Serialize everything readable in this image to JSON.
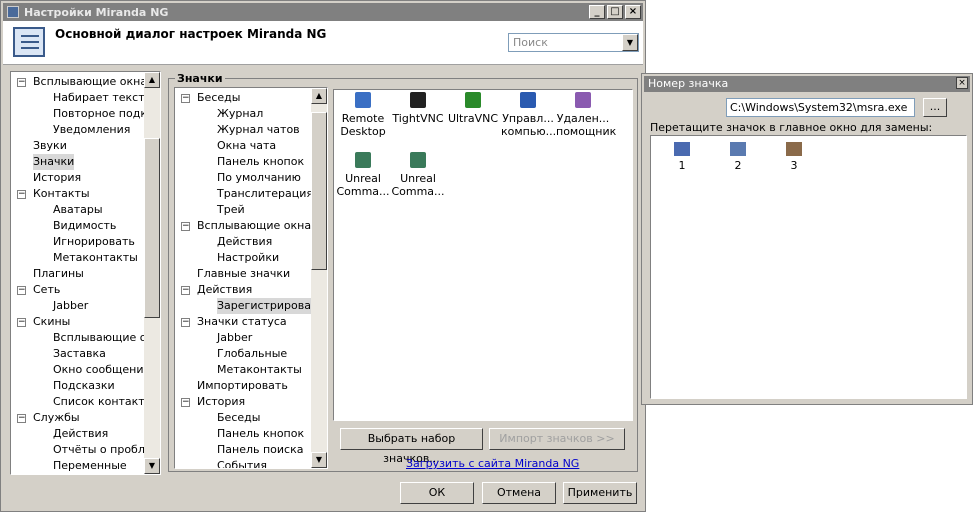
{
  "window": {
    "title": "Настройки Miranda NG",
    "btn_min": "_",
    "btn_max": "□",
    "btn_close": "×"
  },
  "header": {
    "title": "Основной диалог настроек Miranda NG",
    "search_placeholder": "Поиск"
  },
  "nav_tree": [
    {
      "label": "Всплывающие окна",
      "level": 0,
      "exp": "-"
    },
    {
      "label": "Набирает текст",
      "level": 1
    },
    {
      "label": "Повторное подкл",
      "level": 1
    },
    {
      "label": "Уведомления",
      "level": 1
    },
    {
      "label": "Звуки",
      "level": 0
    },
    {
      "label": "Значки",
      "level": 0,
      "selected": true
    },
    {
      "label": "История",
      "level": 0
    },
    {
      "label": "Контакты",
      "level": 0,
      "exp": "-"
    },
    {
      "label": "Аватары",
      "level": 1
    },
    {
      "label": "Видимость",
      "level": 1
    },
    {
      "label": "Игнорировать",
      "level": 1
    },
    {
      "label": "Метаконтакты",
      "level": 1
    },
    {
      "label": "Плагины",
      "level": 0
    },
    {
      "label": "Сеть",
      "level": 0,
      "exp": "-"
    },
    {
      "label": "Jabber",
      "level": 1
    },
    {
      "label": "Скины",
      "level": 0,
      "exp": "-"
    },
    {
      "label": "Всплывающие окн",
      "level": 1
    },
    {
      "label": "Заставка",
      "level": 1
    },
    {
      "label": "Окно сообщений",
      "level": 1
    },
    {
      "label": "Подсказки",
      "level": 1
    },
    {
      "label": "Список контактов",
      "level": 1
    },
    {
      "label": "Службы",
      "level": 0,
      "exp": "-"
    },
    {
      "label": "Действия",
      "level": 1
    },
    {
      "label": "Отчёты о пробле",
      "level": 1
    },
    {
      "label": "Переменные",
      "level": 1
    }
  ],
  "group": {
    "title": "Значки"
  },
  "icon_tree": [
    {
      "label": "Беседы",
      "level": 0,
      "exp": "-"
    },
    {
      "label": "Журнал",
      "level": 1
    },
    {
      "label": "Журнал чатов",
      "level": 1
    },
    {
      "label": "Окна чата",
      "level": 1
    },
    {
      "label": "Панель кнопок",
      "level": 1
    },
    {
      "label": "По умолчанию",
      "level": 1
    },
    {
      "label": "Транслитерация и",
      "level": 1
    },
    {
      "label": "Трей",
      "level": 1
    },
    {
      "label": "Всплывающие окна",
      "level": 0,
      "exp": "-"
    },
    {
      "label": "Действия",
      "level": 1
    },
    {
      "label": "Настройки",
      "level": 1
    },
    {
      "label": "Главные значки",
      "level": 0
    },
    {
      "label": "Действия",
      "level": 0,
      "exp": "-"
    },
    {
      "label": "Зарегистрирован",
      "level": 1,
      "selected": true
    },
    {
      "label": "Значки статуса",
      "level": 0,
      "exp": "-"
    },
    {
      "label": "Jabber",
      "level": 1
    },
    {
      "label": "Глобальные",
      "level": 1
    },
    {
      "label": "Метаконтакты",
      "level": 1
    },
    {
      "label": "Импортировать",
      "level": 0
    },
    {
      "label": "История",
      "level": 0,
      "exp": "-"
    },
    {
      "label": "Беседы",
      "level": 1
    },
    {
      "label": "Панель кнопок",
      "level": 1
    },
    {
      "label": "Панель поиска",
      "level": 1
    },
    {
      "label": "События",
      "level": 1
    }
  ],
  "icons": [
    {
      "line1": "Remote",
      "line2": "Desktop",
      "color": "#3a6fc4",
      "name": "remote-desktop-icon"
    },
    {
      "line1": "TightVNC",
      "line2": "",
      "color": "#222222",
      "name": "tightvnc-icon"
    },
    {
      "line1": "UltraVNC",
      "line2": "",
      "color": "#2a8a2a",
      "name": "ultravnc-icon"
    },
    {
      "line1": "Управл...",
      "line2": "компью...",
      "color": "#2a5ab0",
      "name": "computer-management-icon"
    },
    {
      "line1": "Удален...",
      "line2": "помощник",
      "color": "#8a5ab0",
      "name": "remote-assistance-icon"
    },
    {
      "line1": "Unreal",
      "line2": "Comma...",
      "color": "#3a7a5a",
      "name": "unreal-commander-icon"
    },
    {
      "line1": "Unreal",
      "line2": "Comma...",
      "color": "#3a7a5a",
      "name": "unreal-commander-icon"
    }
  ],
  "buttons": {
    "choose_set": "Выбрать набор значков...",
    "import": "Импорт значков >>",
    "download_link": "Загрузить с сайта Miranda NG",
    "ok": "ОК",
    "cancel": "Отмена",
    "apply": "Применить"
  },
  "dialog": {
    "title": "Номер значка",
    "close": "×",
    "path": "C:\\Windows\\System32\\msra.exe",
    "browse": "...",
    "hint": "Перетащите значок в главное окно для замены:",
    "items": [
      {
        "label": "1"
      },
      {
        "label": "2"
      },
      {
        "label": "3"
      }
    ]
  }
}
